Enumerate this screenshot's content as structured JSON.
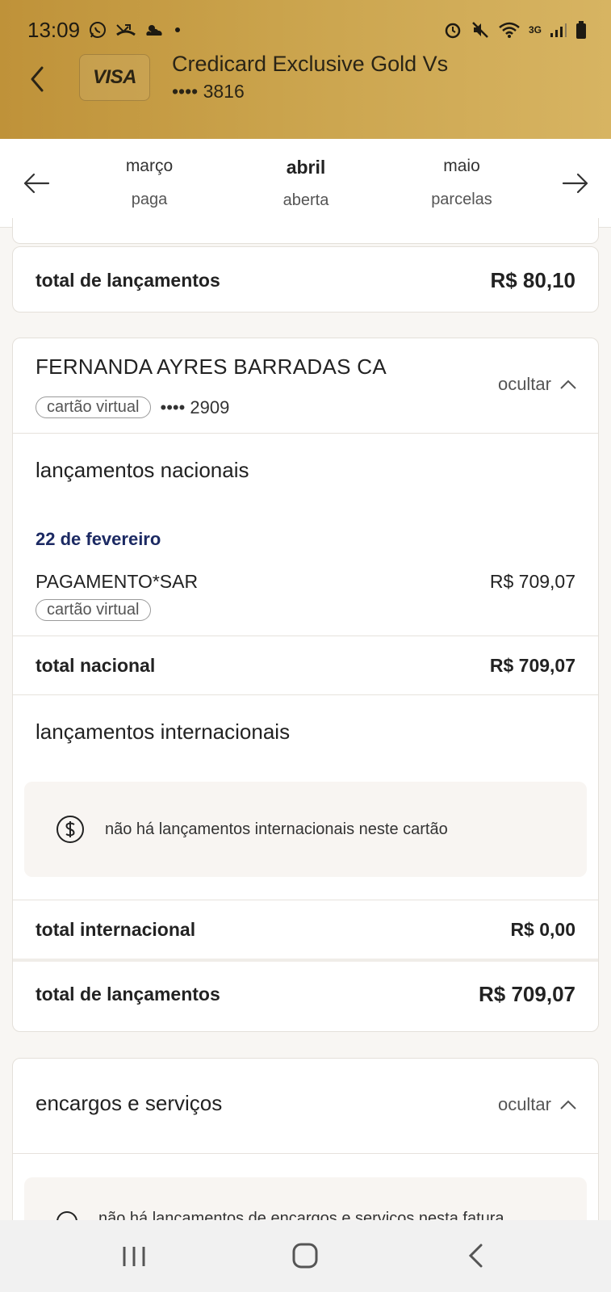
{
  "status_bar": {
    "time": "13:09",
    "network": "3G"
  },
  "header": {
    "brand": "VISA",
    "card_name": "Credicard Exclusive Gold Vs",
    "card_number": "•••• 3816"
  },
  "tabs": [
    {
      "month": "março",
      "status": "paga"
    },
    {
      "month": "abril",
      "status": "aberta",
      "active": true
    },
    {
      "month": "maio",
      "status": "parcelas"
    }
  ],
  "top_summary": {
    "label": "total de lançamentos",
    "value": "R$ 80,10"
  },
  "cardholder": {
    "name": "FERNANDA AYRES BARRADAS CA",
    "card_type": "cartão virtual",
    "card_number": "•••• 2909",
    "toggle_label": "ocultar",
    "national": {
      "title": "lançamentos nacionais",
      "date": "22 de fevereiro",
      "transaction": {
        "description": "PAGAMENTO*SAR",
        "amount": "R$ 709,07",
        "tag": "cartão virtual"
      },
      "total_label": "total nacional",
      "total_value": "R$ 709,07"
    },
    "international": {
      "title": "lançamentos internacionais",
      "empty_message": "não há lançamentos internacionais neste cartão",
      "total_label": "total internacional",
      "total_value": "R$ 0,00"
    },
    "total_label": "total de lançamentos",
    "total_value": "R$ 709,07"
  },
  "charges": {
    "title": "encargos e serviços",
    "toggle_label": "ocultar",
    "partial_text": "não há lançamentos de encargos e serviços nesta fatura"
  },
  "colors": {
    "header_gold": "#c79d45",
    "date_navy": "#1c2a63",
    "background": "#f8f6f3"
  }
}
